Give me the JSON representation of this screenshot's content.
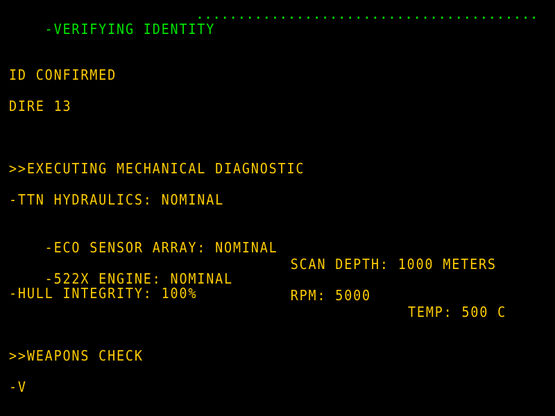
{
  "colors": {
    "background": "#000000",
    "header_green": "#00e600",
    "text_amber": "#ffcc00"
  },
  "header": {
    "title": "-VERIFYING IDENTITY",
    "progress_dots": "............................................................................"
  },
  "identity": {
    "status": "ID CONFIRMED",
    "name": "DIRE 13"
  },
  "diagnostic": {
    "heading": ">>EXECUTING MECHANICAL DIAGNOSTIC",
    "hydraulics": "-TTN HYDRAULICS: NOMINAL",
    "sensor_array": "-ECO SENSOR ARRAY: NOMINAL",
    "scan_depth": "SCAN DEPTH: 1000 METERS",
    "engine": "-522X ENGINE: NOMINAL",
    "rpm": "RPM: 5000",
    "temp": "TEMP: 500 C",
    "hull": "-HULL INTEGRITY: 100%"
  },
  "weapons": {
    "heading": ">>WEAPONS CHECK",
    "partial_line": "-V"
  }
}
